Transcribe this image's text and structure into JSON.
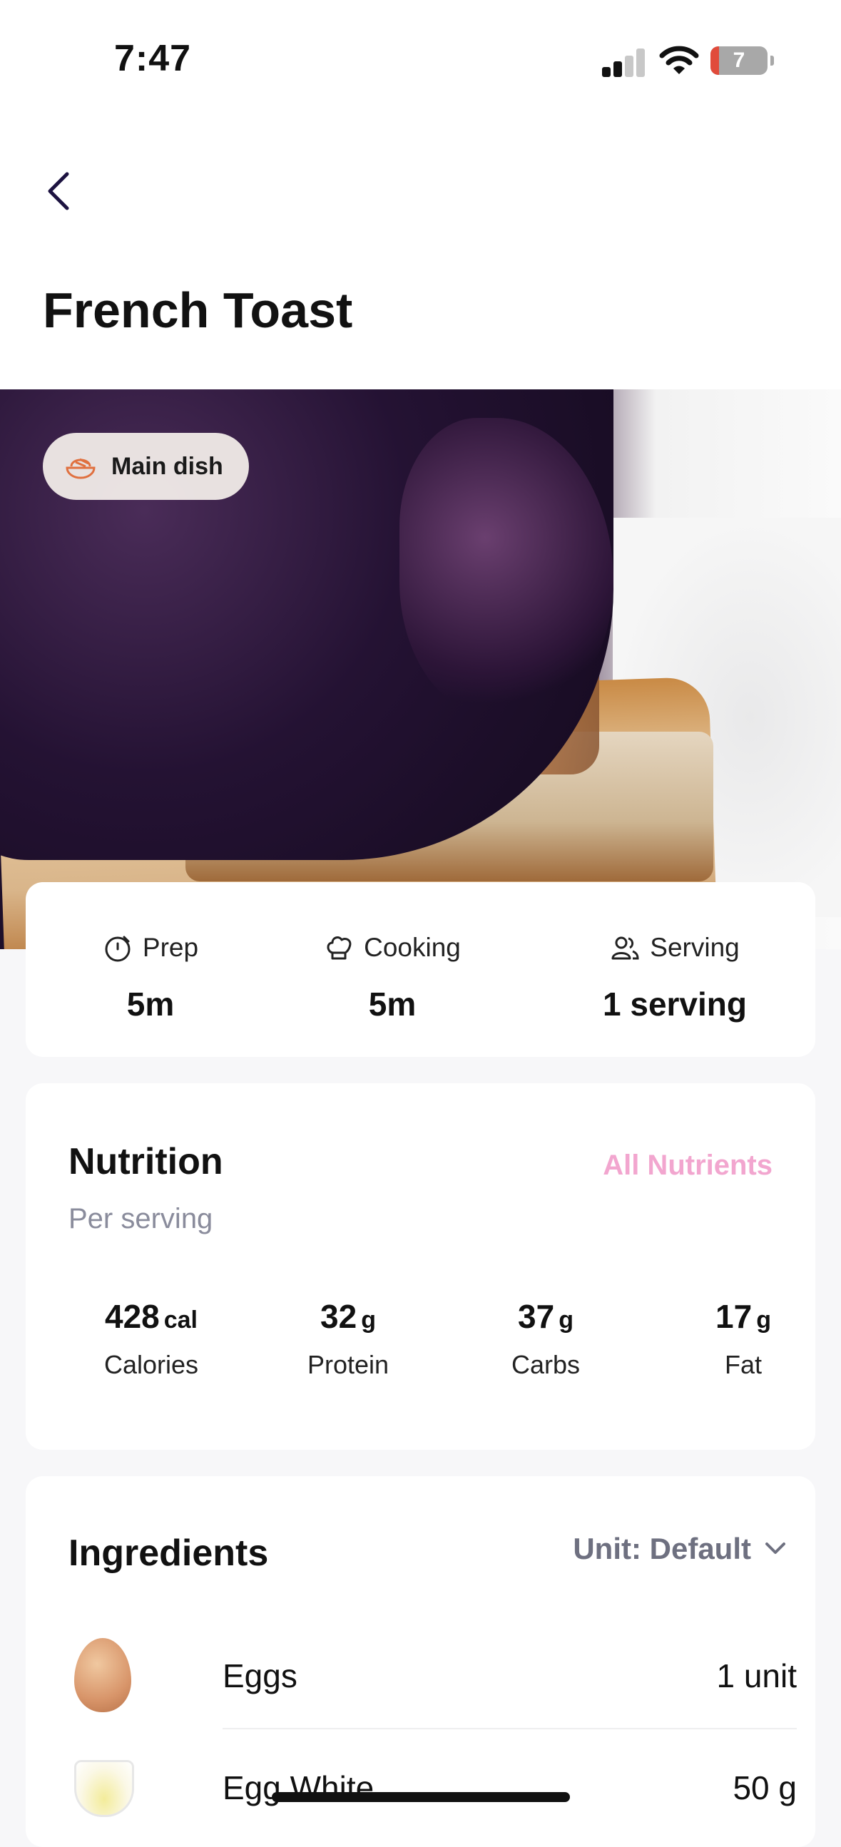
{
  "status_bar": {
    "time": "7:47",
    "battery": "7"
  },
  "header": {
    "title": "French Toast"
  },
  "hero": {
    "tag": "Main dish"
  },
  "meta": [
    {
      "label": "Prep",
      "value": "5m",
      "icon": "timer-icon"
    },
    {
      "label": "Cooking",
      "value": "5m",
      "icon": "chef-hat-icon"
    },
    {
      "label": "Serving",
      "value": "1 serving",
      "icon": "people-icon"
    }
  ],
  "nutrition": {
    "title": "Nutrition",
    "link": "All Nutrients",
    "subtitle": "Per serving",
    "items": [
      {
        "value": "428",
        "unit": "cal",
        "label": "Calories"
      },
      {
        "value": "32",
        "unit": "g",
        "label": "Protein"
      },
      {
        "value": "37",
        "unit": "g",
        "label": "Carbs"
      },
      {
        "value": "17",
        "unit": "g",
        "label": "Fat"
      }
    ],
    "link_color": "#f2a6cf"
  },
  "ingredients": {
    "title": "Ingredients",
    "unit_selector": "Unit: Default",
    "items": [
      {
        "name": "Eggs",
        "qty": "1 unit",
        "icon": "egg-image"
      },
      {
        "name": "Egg White",
        "qty": "50 g",
        "icon": "egg-white-image"
      }
    ]
  }
}
